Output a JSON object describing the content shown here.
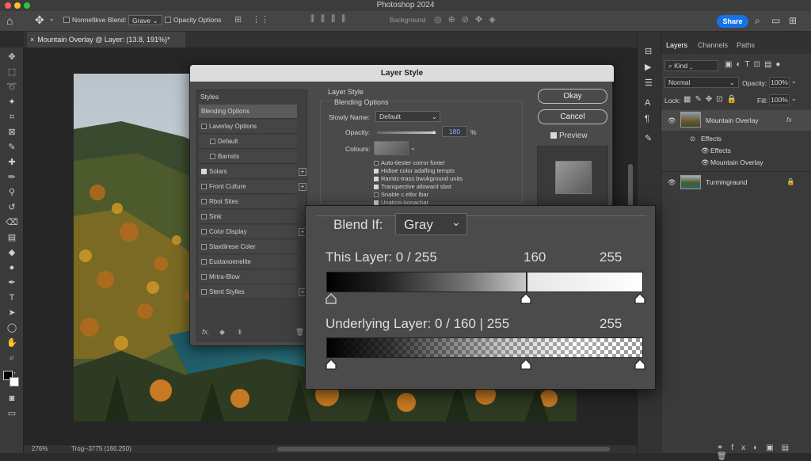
{
  "app": {
    "title": "Photoshop 2024"
  },
  "options_bar": {
    "nondestructive_label": "Nonnefikve Blend:",
    "blend_value": "Grave",
    "opacity_options_label": "Opacity Options",
    "background_label": "Background",
    "share_label": "Share"
  },
  "document_tab": {
    "label": "Mountain Overlay @ Layer: (13.8, 191%)*",
    "close": "×"
  },
  "status": {
    "zoom": "276%",
    "info": "Trog--3775 (160.250)"
  },
  "layers_panel": {
    "tabs": [
      "Layers",
      "Channels",
      "Paths"
    ],
    "kind_value": "Kind",
    "blend_mode": "Normal",
    "opacity_label": "Opacity:",
    "opacity_value": "100%",
    "lock_label": "Lock:",
    "fill_label": "Fill:",
    "fill_value": "100%",
    "layers": [
      {
        "name": "Mountain Overlay",
        "fx": "fx"
      },
      {
        "name": "Effects"
      },
      {
        "name": "Effects"
      },
      {
        "name": "Mountain Overlay"
      },
      {
        "name": "Turmingraund"
      }
    ]
  },
  "dialog": {
    "title": "Layer Style",
    "styles_header": "Styles",
    "styles": [
      "Blending Options",
      "Laverlay Options",
      "Default",
      "Barnsts",
      "Solars",
      "Front Culture",
      "Rbot Sites",
      "Sink",
      "Color Display",
      "Staxtiirese Coler",
      "Eustanoenelite",
      "Mrtra-Blow",
      "Stent Stylles"
    ],
    "section_title": "Layer Style",
    "section_sub": "Blending Options",
    "slowly_name_label": "Slowly Name:",
    "slowly_name_value": "Default",
    "opacity_label": "Opacity:",
    "opacity_value": "180",
    "opacity_unit": "%",
    "colours_label": "Colours:",
    "options": [
      "Auto-tiester corror fonte!",
      "Hidtoe color adafling tempts",
      "Ramtic-trass bwukground units",
      "Transpective ailoward sbot",
      "Snable c.ellor lbar",
      "Unaticis-konachar"
    ],
    "ok_label": "Okay",
    "cancel_label": "Cancel",
    "preview_label": "Preview",
    "fx_label": "fx."
  },
  "blend_if": {
    "label": "Blend If:",
    "channel": "Gray",
    "this_layer_label": "This Layer: 0 / 255",
    "this_layer_mid": "160",
    "this_layer_max": "255",
    "underlying_label": "Underlying Layer: 0 / 160 | 255",
    "underlying_max": "255",
    "this_layer_split": 0.63,
    "underlying_mid": 0.63
  },
  "colors": {
    "accent": "#1473e6",
    "panel": "#3a3a3a",
    "dialog": "#4a4a4a"
  }
}
